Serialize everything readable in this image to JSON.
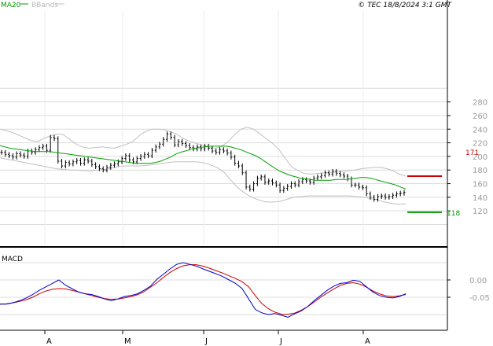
{
  "header": {
    "ma_label": "MA20",
    "bands_label": "BBands",
    "copyright": "© TEC 18/8/2024 3:1 GMT"
  },
  "macd_panel": {
    "title": "MACD"
  },
  "markers": {
    "upper": {
      "value": 171,
      "label": "171"
    },
    "lower": {
      "value": 118,
      "label": "118"
    }
  },
  "colors": {
    "ma": "#00a000",
    "bands": "#c0c0c0",
    "price": "#000000",
    "macd": "#0000cc",
    "signal": "#cc0000",
    "upper_marker": "#cc0000",
    "lower_marker": "#009900",
    "grid": "#dcdcdc"
  },
  "chart_data": [
    {
      "type": "line",
      "title": "",
      "x_ticks": [
        "A",
        "M",
        "J",
        "J",
        "A"
      ],
      "y_ticks": [
        "280",
        "260",
        "240",
        "220",
        "200",
        "180",
        "160",
        "140",
        "120"
      ],
      "ylim": [
        100,
        290
      ],
      "grid": true,
      "series": [
        {
          "name": "price",
          "style": "ohlc-bars",
          "values": [
            206,
            203,
            201,
            199,
            204,
            202,
            200,
            208,
            206,
            210,
            213,
            215,
            209,
            228,
            226,
            193,
            186,
            191,
            189,
            192,
            194,
            190,
            195,
            193,
            188,
            185,
            182,
            180,
            184,
            187,
            189,
            192,
            197,
            201,
            195,
            192,
            197,
            200,
            203,
            201,
            209,
            214,
            218,
            225,
            233,
            228,
            217,
            222,
            219,
            216,
            213,
            211,
            214,
            211,
            215,
            212,
            208,
            206,
            210,
            208,
            205,
            199,
            190,
            186,
            176,
            155,
            152,
            160,
            168,
            170,
            162,
            164,
            161,
            158,
            150,
            153,
            156,
            160,
            158,
            163,
            166,
            164,
            162,
            168,
            170,
            172,
            176,
            174,
            178,
            175,
            173,
            171,
            167,
            158,
            158,
            155,
            154,
            145,
            140,
            137,
            141,
            142,
            140,
            141,
            143,
            145,
            146,
            147
          ]
        },
        {
          "name": "MA20",
          "values": [
            216,
            214,
            212,
            211,
            210,
            209,
            208,
            207,
            207,
            207,
            207,
            206,
            205,
            204,
            203,
            202,
            201,
            200,
            199,
            198,
            197,
            196,
            195,
            194,
            193,
            192,
            191,
            190,
            190,
            190,
            190,
            191,
            193,
            196,
            199,
            203,
            206,
            208,
            210,
            212,
            213,
            214,
            215,
            215,
            215,
            215,
            214,
            212,
            210,
            207,
            204,
            201,
            197,
            192,
            187,
            182,
            178,
            175,
            172,
            170,
            168,
            167,
            166,
            165,
            165,
            165,
            165,
            166,
            166,
            166,
            167,
            168,
            169,
            169,
            168,
            166,
            164,
            162,
            160,
            158,
            155,
            152
          ]
        },
        {
          "name": "upper",
          "values": [
            240,
            238,
            235,
            231,
            227,
            223,
            222,
            227,
            230,
            233,
            232,
            225,
            218,
            214,
            212,
            213,
            214,
            213,
            212,
            215,
            218,
            222,
            231,
            237,
            240,
            240,
            239,
            236,
            232,
            226,
            222,
            219,
            216,
            213,
            212,
            215,
            222,
            232,
            240,
            243,
            240,
            233,
            226,
            219,
            210,
            197,
            185,
            179,
            175,
            174,
            175,
            176,
            176,
            177,
            178,
            179,
            180,
            182,
            183,
            184,
            184,
            182,
            179,
            174,
            171
          ]
        },
        {
          "name": "lower",
          "values": [
            198,
            196,
            194,
            192,
            190,
            188,
            186,
            184,
            182,
            181,
            180,
            180,
            179,
            179,
            180,
            181,
            183,
            185,
            186,
            186,
            186,
            187,
            188,
            189,
            191,
            192,
            192,
            192,
            192,
            191,
            188,
            184,
            177,
            165,
            154,
            146,
            140,
            136,
            133,
            133,
            134,
            137,
            140,
            141,
            142,
            142,
            142,
            142,
            142,
            142,
            142,
            141,
            140,
            138,
            136,
            133,
            131,
            130,
            130
          ]
        }
      ]
    },
    {
      "type": "line",
      "title": "MACD",
      "y_ticks": [
        "0.00",
        "-0.05"
      ],
      "ylim": [
        -0.12,
        0.06
      ],
      "grid": true,
      "series": [
        {
          "name": "macd",
          "values": [
            -0.07,
            -0.07,
            -0.066,
            -0.06,
            -0.052,
            -0.042,
            -0.03,
            -0.02,
            -0.01,
            0.0,
            -0.015,
            -0.025,
            -0.035,
            -0.04,
            -0.042,
            -0.048,
            -0.055,
            -0.06,
            -0.055,
            -0.048,
            -0.045,
            -0.04,
            -0.03,
            -0.018,
            0.002,
            0.017,
            0.032,
            0.045,
            0.05,
            0.045,
            0.04,
            0.032,
            0.025,
            0.018,
            0.01,
            0.0,
            -0.01,
            -0.025,
            -0.055,
            -0.085,
            -0.095,
            -0.1,
            -0.097,
            -0.102,
            -0.108,
            -0.098,
            -0.09,
            -0.077,
            -0.06,
            -0.045,
            -0.03,
            -0.018,
            -0.01,
            -0.008,
            -0.001,
            -0.004,
            -0.02,
            -0.035,
            -0.045,
            -0.05,
            -0.052,
            -0.048,
            -0.04
          ]
        },
        {
          "name": "signal",
          "values": [
            -0.07,
            -0.069,
            -0.066,
            -0.062,
            -0.057,
            -0.05,
            -0.04,
            -0.032,
            -0.027,
            -0.025,
            -0.026,
            -0.03,
            -0.035,
            -0.04,
            -0.045,
            -0.05,
            -0.054,
            -0.056,
            -0.055,
            -0.052,
            -0.048,
            -0.043,
            -0.034,
            -0.021,
            -0.008,
            0.008,
            0.022,
            0.033,
            0.041,
            0.044,
            0.044,
            0.04,
            0.034,
            0.027,
            0.02,
            0.012,
            0.004,
            -0.005,
            -0.02,
            -0.045,
            -0.068,
            -0.083,
            -0.093,
            -0.099,
            -0.099,
            -0.096,
            -0.088,
            -0.077,
            -0.064,
            -0.05,
            -0.038,
            -0.026,
            -0.016,
            -0.01,
            -0.008,
            -0.012,
            -0.021,
            -0.032,
            -0.04,
            -0.046,
            -0.048,
            -0.046,
            -0.042
          ]
        }
      ]
    }
  ]
}
